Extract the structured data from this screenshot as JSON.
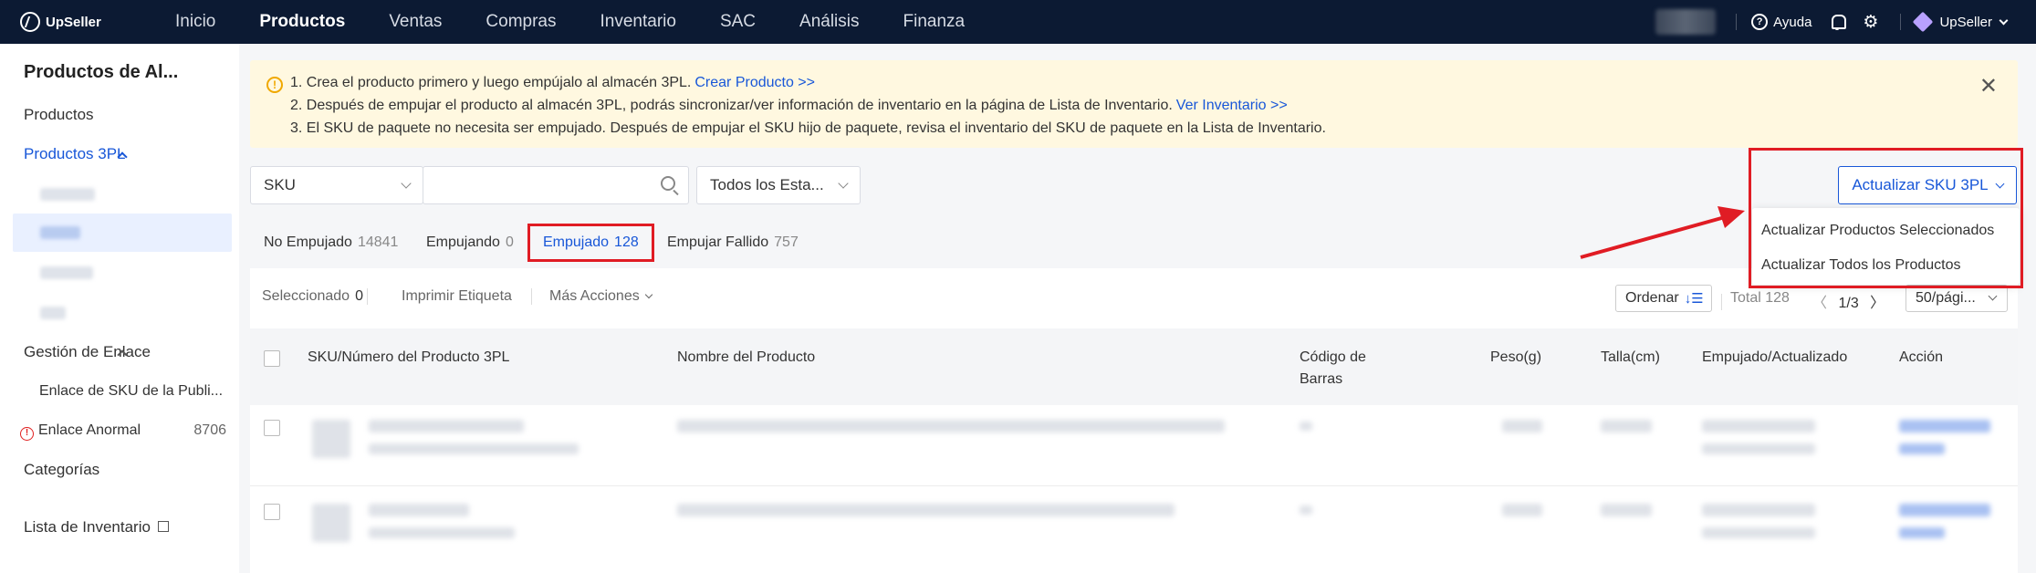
{
  "brand": {
    "name": "UpSeller"
  },
  "nav": {
    "items": [
      "Inicio",
      "Productos",
      "Ventas",
      "Compras",
      "Inventario",
      "SAC",
      "Análisis",
      "Finanza"
    ],
    "active": "Productos"
  },
  "topbar": {
    "help_label": "Ayuda",
    "user_label": "UpSeller"
  },
  "sidebar": {
    "title": "Productos de Al...",
    "productos": "Productos",
    "productos_3pl": "Productos 3PL",
    "gestion_enlace": "Gestión de Enlace",
    "enlace_sku": "Enlace de SKU de la Publi...",
    "enlace_anormal": "Enlace Anormal",
    "enlace_anormal_count": "8706",
    "categorias": "Categorías",
    "lista_inventario": "Lista de Inventario"
  },
  "notice": {
    "line1": "1. Crea el producto primero y luego empújalo al almacén 3PL.",
    "line1_link": "Crear Producto >>",
    "line2": "2. Después de empujar el producto al almacén 3PL, podrás sincronizar/ver información de inventario en la página de Lista de Inventario.",
    "line2_link": "Ver Inventario >>",
    "line3": "3. El SKU de paquete no necesita ser empujado. Después de empujar el SKU hijo de paquete, revisa el inventario del SKU de paquete en la Lista de Inventario."
  },
  "filters": {
    "search_type": "SKU",
    "search_placeholder": "",
    "status": "Todos los Esta..."
  },
  "update_button": {
    "label": "Actualizar SKU 3PL"
  },
  "dropdown": {
    "items": [
      "Actualizar Productos Seleccionados",
      "Actualizar Todos los Productos"
    ]
  },
  "tabs": [
    {
      "label": "No Empujado",
      "count": "14841"
    },
    {
      "label": "Empujando",
      "count": "0"
    },
    {
      "label": "Empujado",
      "count": "128"
    },
    {
      "label": "Empujar Fallido",
      "count": "757"
    }
  ],
  "toolbar": {
    "selected_label": "Seleccionado",
    "selected_count": "0",
    "print_label": "Imprimir Etiqueta",
    "more_label": "Más Acciones",
    "order_label": "Ordenar",
    "total": "Total 128",
    "page": "1/3",
    "per_page": "50/pági..."
  },
  "table": {
    "headers": [
      "SKU/Número del Producto 3PL",
      "Nombre del Producto",
      "Código de Barras",
      "Peso(g)",
      "Talla(cm)",
      "Empujado/Actualizado",
      "Acción"
    ]
  },
  "colors": {
    "accent": "#1857d8",
    "highlight": "#e01c24",
    "topbar": "#0c1a33",
    "notice_bg": "#fff8e0"
  }
}
